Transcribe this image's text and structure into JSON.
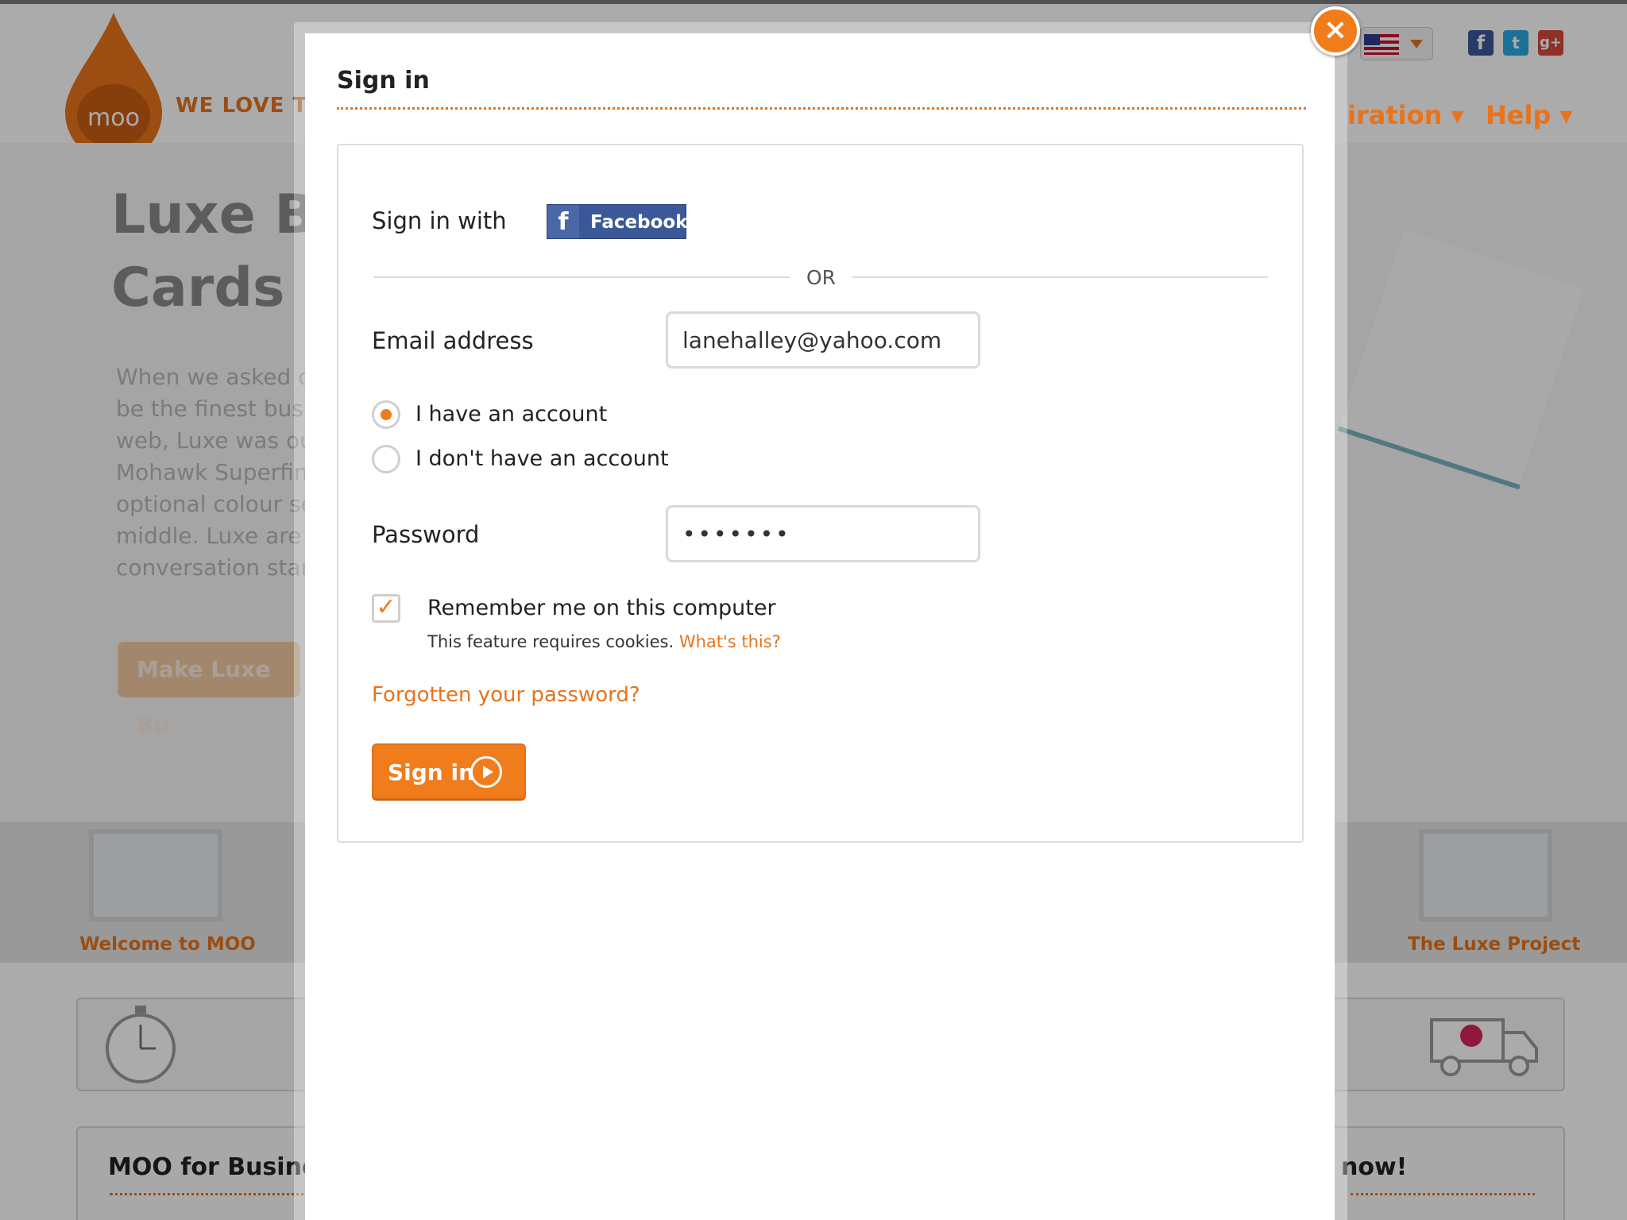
{
  "background": {
    "tagline": "WE LOVE T",
    "nav": {
      "inspiration": "iration ▾",
      "help": "Help ▾"
    },
    "hero": {
      "title_line1": "Luxe Bu",
      "title_line2": "Cards",
      "text_lines": [
        "When we asked o",
        "be the finest busi",
        "web, Luxe was ou",
        "Mohawk Superfin",
        "optional colour se",
        "middle. Luxe are",
        "conversation star"
      ],
      "button": "Make Luxe Bu"
    },
    "thumbs": {
      "left_label": "Welcome to MOO",
      "right_label": "The Luxe Project"
    },
    "bottom": {
      "left_title": "MOO for Busines",
      "right_title": "now!"
    }
  },
  "modal": {
    "title": "Sign in",
    "close_icon": "close-icon",
    "sign_in_with": "Sign in with",
    "facebook_label": "Facebook",
    "or": "OR",
    "email_label": "Email address",
    "email_value": "lanehalley@yahoo.com",
    "radio_have": "I have an account",
    "radio_dont": "I don't have an account",
    "password_label": "Password",
    "password_value": "•••••••",
    "remember_label": "Remember me on this computer",
    "cookies_note": "This feature requires cookies.",
    "whats_this": "What's this?",
    "forgot_link": "Forgotten your password?",
    "sign_in_button": "Sign in"
  },
  "colors": {
    "accent": "#f07c1c",
    "facebook": "#3b5998"
  }
}
